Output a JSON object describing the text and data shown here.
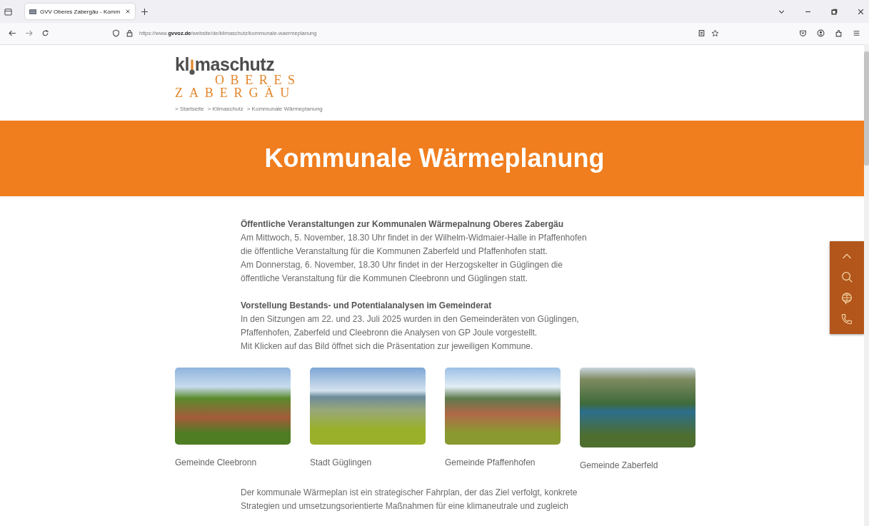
{
  "browser": {
    "tab": {
      "title": "GVV Oberes Zabergäu - Komm",
      "selected": true
    },
    "url": "https://www.**gvvoz.de**/website/de/klimaschutz/kommunale-waermeplanung"
  },
  "logo": {
    "start": "kl",
    "end": "maschutz",
    "line2": "OBERES",
    "line3": "ZABERGÄU"
  },
  "breadcrumb": [
    "> Startseite",
    "> Klimaschutz",
    "> Kommunale Wärmeplanung"
  ],
  "banner": {
    "title": "Kommunale Wärmeplanung"
  },
  "sections": [
    {
      "heading": "Öffentliche Veranstaltungen zur Kommunalen Wärmepalnung Oberes Zabergäu",
      "lines": [
        "Am Mittwoch, 5. November, 18.30 Uhr findet in der Wilhelm-Widmaier-Halle in Pfaffenhofen",
        "die öffentliche Veranstaltung für die Kommunen Zaberfeld und Pfaffenhofen statt.",
        "Am Donnerstag, 6. November, 18.30 Uhr  findet in der Herzogskelter in Güglingen die",
        "öffentliche Veranstaltung für die Kommunen Cleebronn und Güglingen statt."
      ]
    },
    {
      "heading": "Vorstellung Bestands- und Potentialanalysen im Gemeinderat",
      "lines": [
        "In den Sitzungen am 22. und 23. Juli 2025 wurden in den Gemeinderäten von Güglingen,",
        "Pfaffenhofen, Zaberfeld und Cleebronn die Analysen von GP Joule vorgestellt.",
        "Mit Klicken auf das Bild öffnet sich die Präsentation zur jeweiligen Kommune."
      ]
    }
  ],
  "communities": [
    {
      "caption": "Gemeinde Cleebronn"
    },
    {
      "caption": "Stadt Güglingen"
    },
    {
      "caption": "Gemeinde Pfaffenhofen"
    },
    {
      "caption": "Gemeinde Zaberfeld"
    }
  ],
  "intro": {
    "lines": [
      "Der kommunale Wärmeplan ist ein strategischer Fahrplan, der das Ziel verfolgt, konkrete",
      "Strategien und umsetzungsorientierte Maßnahmen für eine klimaneutrale und zugleich"
    ]
  }
}
